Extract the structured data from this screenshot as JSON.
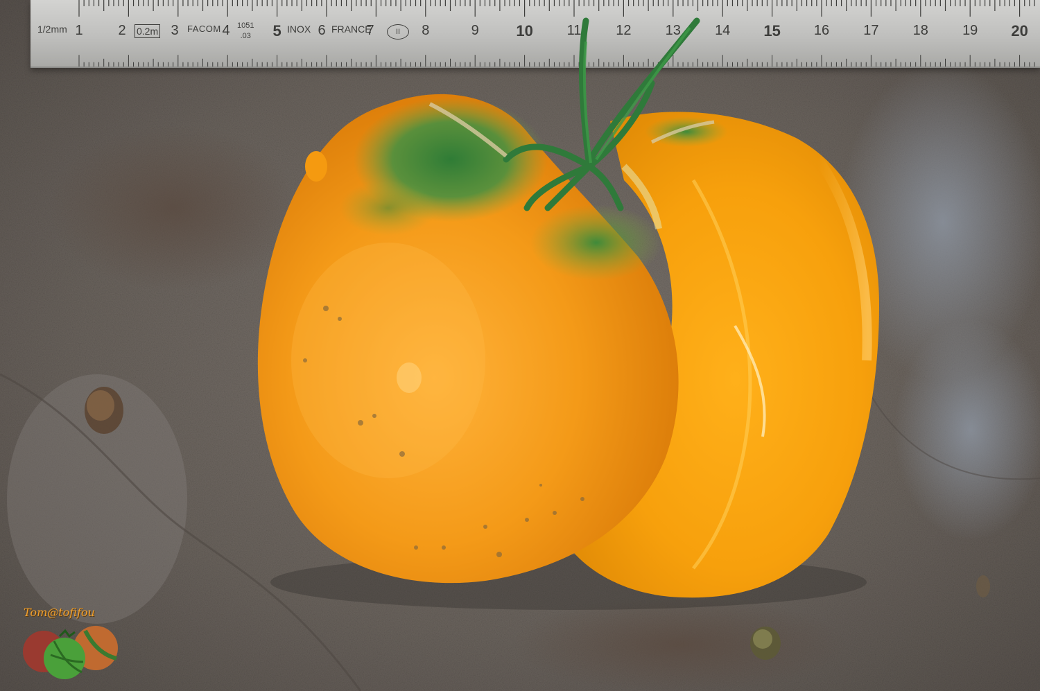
{
  "ruler": {
    "scale_label": "1/2mm",
    "spec_box": "0.2m",
    "brand": "FACOM",
    "model_top": "1051",
    "model_bottom": ".03",
    "inox": "INOX",
    "france": "FRANCE",
    "class_mark": "II",
    "numbers": [
      "1",
      "2",
      "3",
      "4",
      "5",
      "6",
      "7",
      "8",
      "9",
      "10",
      "11",
      "12",
      "13",
      "14",
      "15",
      "16",
      "17",
      "18",
      "19",
      "20"
    ]
  },
  "watermark": {
    "text": "Tom@tofifou"
  },
  "colors": {
    "tomato_orange": "#f4a21c",
    "flesh_orange": "#f7aa10",
    "shoulder_green": "#3f8a3a",
    "stem_green": "#2f7a3a",
    "stone_gray": "#6f6963",
    "ruler_steel": "#c4c4c2"
  }
}
